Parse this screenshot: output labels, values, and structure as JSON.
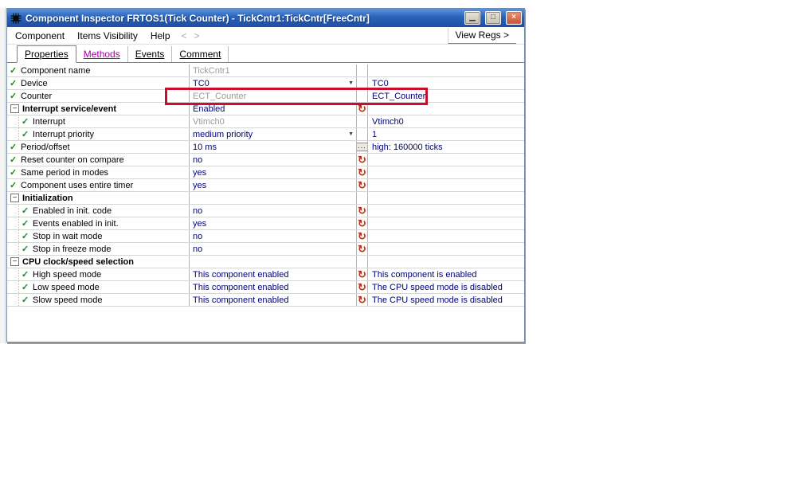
{
  "window": {
    "title": "Component Inspector FRTOS1(Tick Counter) - TickCntr1:TickCntr[FreeCntr]",
    "controls": {
      "minimize": "▁",
      "restore": "□",
      "close": "×"
    }
  },
  "menu": {
    "items": [
      "Component",
      "Items Visibility",
      "Help"
    ],
    "back_arrow": "<",
    "forward_arrow": ">",
    "view_regs_label": "View Regs >"
  },
  "tabs": [
    {
      "label": "Properties",
      "active": true,
      "color": "#000000"
    },
    {
      "label": "Methods",
      "active": false,
      "color": "#a000a0"
    },
    {
      "label": "Events",
      "active": false,
      "color": "#000000"
    },
    {
      "label": "Comment",
      "active": false,
      "color": "#000000"
    }
  ],
  "icons": {
    "check": "✓",
    "collapse": "−",
    "cycle": "↻",
    "dropdown": "▼",
    "ellipsis": "...",
    "app": "chip-icon"
  },
  "colors": {
    "value_text": "#00007b",
    "disabled_value_text": "#9c9c94",
    "check_green": "#1d8a1d",
    "cycle_red": "#cc2b00",
    "methods_tab": "#a000a0",
    "highlight_box": "#c8102e",
    "titlebar_blue": "#2b62b8"
  },
  "grid": {
    "rows": [
      {
        "kind": "prop",
        "indent": 0,
        "label": "Component name",
        "value": "TickCntr1",
        "gray": true
      },
      {
        "kind": "prop",
        "indent": 0,
        "label": "Device",
        "value": "TC0",
        "dropdown": true,
        "right": "TC0"
      },
      {
        "kind": "prop",
        "indent": 0,
        "label": "Counter",
        "value": "ECT_Counter",
        "gray": true,
        "right": "ECT_Counter",
        "highlight": true
      },
      {
        "kind": "group",
        "label": "Interrupt service/event",
        "value": "Enabled",
        "cycle": true
      },
      {
        "kind": "prop",
        "indent": 1,
        "label": "Interrupt",
        "value": "Vtimch0",
        "gray": true,
        "right": "Vtimch0"
      },
      {
        "kind": "prop",
        "indent": 1,
        "label": "Interrupt priority",
        "value": "medium priority",
        "dropdown": true,
        "right": "1"
      },
      {
        "kind": "prop",
        "indent": 0,
        "label": "Period/offset",
        "value": "10 ms",
        "ellipsis": true,
        "right": "high: 160000 ticks"
      },
      {
        "kind": "prop",
        "indent": 0,
        "label": "Reset counter on compare",
        "value": "no",
        "cycle": true
      },
      {
        "kind": "prop",
        "indent": 0,
        "label": "Same period in modes",
        "value": "yes",
        "cycle": true
      },
      {
        "kind": "prop",
        "indent": 0,
        "label": "Component uses entire timer",
        "value": "yes",
        "cycle": true
      },
      {
        "kind": "group",
        "label": "Initialization"
      },
      {
        "kind": "prop",
        "indent": 1,
        "label": "Enabled in init. code",
        "value": "no",
        "cycle": true
      },
      {
        "kind": "prop",
        "indent": 1,
        "label": "Events enabled in init.",
        "value": "yes",
        "cycle": true
      },
      {
        "kind": "prop",
        "indent": 1,
        "label": "Stop in wait mode",
        "value": "no",
        "cycle": true
      },
      {
        "kind": "prop",
        "indent": 1,
        "label": "Stop in freeze mode",
        "value": "no",
        "cycle": true
      },
      {
        "kind": "group",
        "label": "CPU clock/speed selection"
      },
      {
        "kind": "prop",
        "indent": 1,
        "label": "High speed mode",
        "value": "This component enabled",
        "cycle": true,
        "right": "This component is enabled"
      },
      {
        "kind": "prop",
        "indent": 1,
        "label": "Low speed mode",
        "value": "This component enabled",
        "cycle": true,
        "right": "The CPU speed mode is disabled"
      },
      {
        "kind": "prop",
        "indent": 1,
        "label": "Slow speed mode",
        "value": "This component enabled",
        "cycle": true,
        "right": "The CPU speed mode is disabled"
      }
    ]
  }
}
